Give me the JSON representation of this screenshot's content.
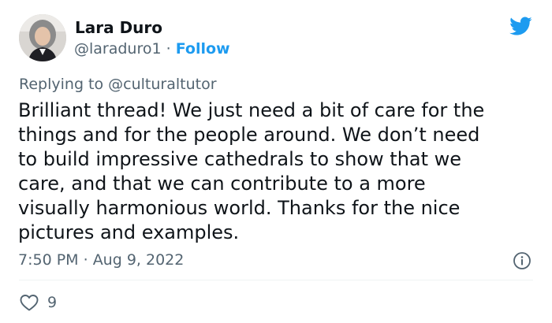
{
  "author": {
    "display_name": "Lara Duro",
    "handle": "@laraduro1",
    "separator": " · ",
    "follow_label": "Follow"
  },
  "reply": {
    "prefix": "Replying to ",
    "target": "@culturaltutor"
  },
  "tweet": {
    "lines": [
      "Brilliant thread! We just need a bit of care for the",
      "things and for the people around. We don’t need",
      "to build impressive cathedrals to show that we",
      "care, and that we can contribute to a more",
      "visually harmonious world. Thanks for the nice",
      "pictures and examples."
    ],
    "time": "7:50 PM",
    "date_separator": " · ",
    "date": "Aug 9, 2022"
  },
  "stats": {
    "likes": "9"
  },
  "icons": {
    "brand": "twitter-bird-icon",
    "info": "info-icon",
    "like": "heart-icon"
  },
  "colors": {
    "accent": "#1d9bf0",
    "secondary_text": "#536471",
    "primary_text": "#0f1419",
    "divider": "#eff3f4"
  }
}
